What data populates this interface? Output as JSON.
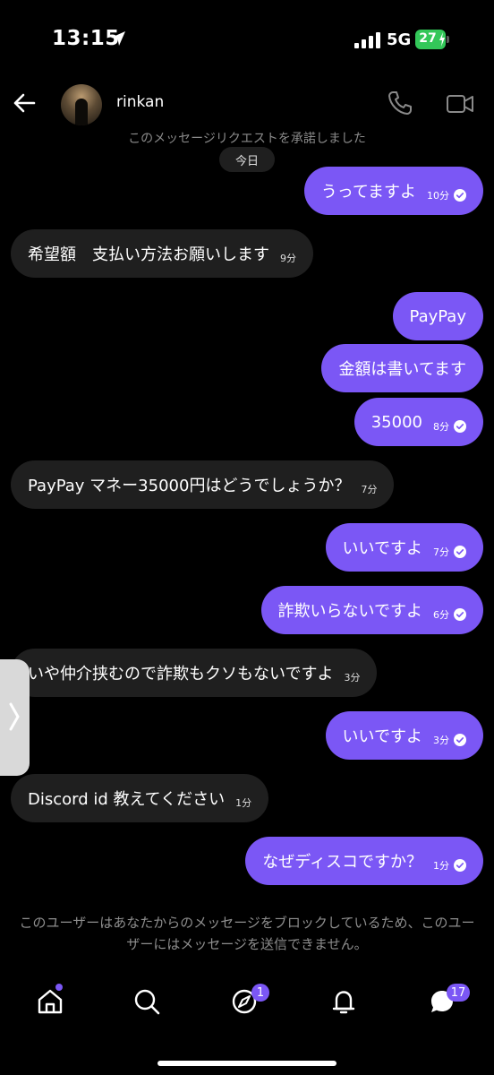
{
  "status_bar": {
    "time": "13:15",
    "network": "5G",
    "battery": "27"
  },
  "header": {
    "username": "rinkan"
  },
  "request_note": "このメッセージリクエストを承諾しました",
  "date_label": "今日",
  "messages": [
    {
      "direction": "sent",
      "text": "うってますよ",
      "time": "10分",
      "read": true
    },
    {
      "direction": "received",
      "text": "希望額　支払い方法お願いします",
      "time": "9分"
    },
    {
      "direction": "sent",
      "text": "PayPay"
    },
    {
      "direction": "sent",
      "text": "金額は書いてます"
    },
    {
      "direction": "sent",
      "text": "35000",
      "time": "8分",
      "read": true
    },
    {
      "direction": "received",
      "text": "PayPay マネー35000円はどうでしょうか？",
      "time": "7分"
    },
    {
      "direction": "sent",
      "text": "いいですよ",
      "time": "7分",
      "read": true
    },
    {
      "direction": "sent",
      "text": "詐欺いらないですよ",
      "time": "6分",
      "read": true
    },
    {
      "direction": "received",
      "text": "いや仲介挟むので詐欺もクソもないですよ",
      "time": "3分"
    },
    {
      "direction": "sent",
      "text": "いいですよ",
      "time": "3分",
      "read": true
    },
    {
      "direction": "received",
      "text": "Discord id 教えてください",
      "time": "1分"
    },
    {
      "direction": "sent",
      "text": "なぜディスコですか？",
      "time": "1分",
      "read": true
    }
  ],
  "blocked_note": "このユーザーはあなたからのメッセージをブロックしているため、このユーザーにはメッセージを送信できません。",
  "bottom_nav": {
    "items": [
      {
        "icon": "home-icon"
      },
      {
        "icon": "search-icon"
      },
      {
        "icon": "explore-icon",
        "badge": "1"
      },
      {
        "icon": "bell-icon"
      },
      {
        "icon": "chat-icon",
        "badge": "17"
      }
    ]
  },
  "colors": {
    "accent": "#7b57f5",
    "received_bubble": "#1f1f1f",
    "background": "#000000",
    "battery": "#33c759"
  }
}
